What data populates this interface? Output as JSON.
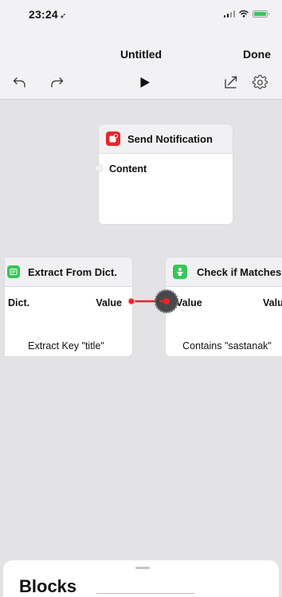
{
  "status_bar": {
    "time": "23:24",
    "location_glyph": "➶"
  },
  "nav": {
    "title": "Untitled",
    "done_label": "Done"
  },
  "toolbar": {
    "undo_icon": "undo-icon",
    "redo_icon": "redo-icon",
    "play_icon": "play-icon",
    "share_icon": "share-icon",
    "settings_icon": "gear-icon"
  },
  "blocks": {
    "send_notification": {
      "title": "Send Notification",
      "input_label": "Content",
      "icon_color": "#e8252a"
    },
    "extract_dict": {
      "title": "Extract From Dict.",
      "input_label": "Dict.",
      "output_label": "Value",
      "footer": "Extract Key \"title\"",
      "icon_color": "#35c759"
    },
    "check_matches": {
      "title": "Check if Matches",
      "input_label": "Value",
      "output_label": "Valu",
      "footer": "Contains \"sastanak\"",
      "icon_color": "#35c759"
    }
  },
  "connection_color": "#e8252a",
  "bottom_sheet": {
    "title": "Blocks"
  }
}
